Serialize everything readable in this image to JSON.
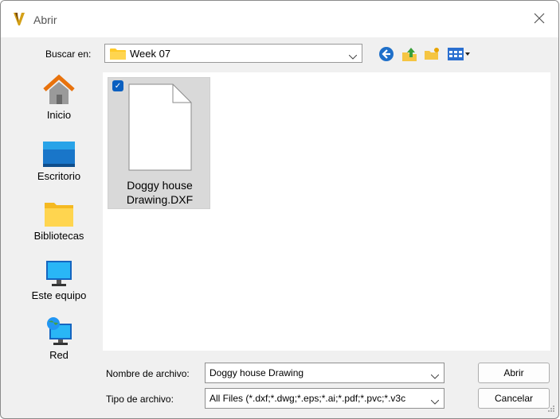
{
  "window": {
    "title": "Abrir"
  },
  "lookin": {
    "label": "Buscar en:",
    "value": "Week 07"
  },
  "places": [
    {
      "label": "Inicio"
    },
    {
      "label": "Escritorio"
    },
    {
      "label": "Bibliotecas"
    },
    {
      "label": "Este equipo"
    },
    {
      "label": "Red"
    }
  ],
  "files": [
    {
      "line1": "Doggy house",
      "line2": "Drawing.DXF",
      "selected": true
    }
  ],
  "filename": {
    "label": "Nombre de archivo:",
    "value": "Doggy house Drawing"
  },
  "filetype": {
    "label": "Tipo de archivo:",
    "value": "All Files (*.dxf;*.dwg;*.eps;*.ai;*.pdf;*.pvc;*.v3c"
  },
  "buttons": {
    "open": "Abrir",
    "cancel": "Cancelar"
  },
  "colors": {
    "accent": "#0a5fc0",
    "folder": "#ffca28"
  }
}
